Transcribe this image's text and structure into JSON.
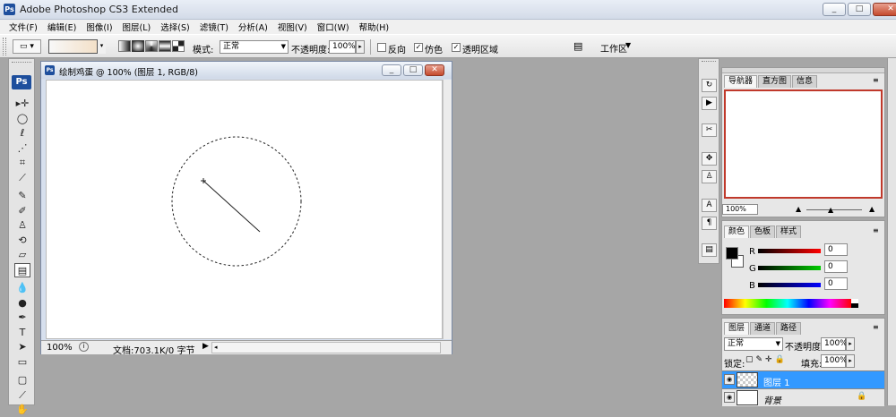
{
  "app": {
    "title": "Adobe Photoshop CS3 Extended",
    "logo": "Ps",
    "window_buttons": [
      "_",
      "□",
      "✕"
    ]
  },
  "menu": [
    "文件(F)",
    "编辑(E)",
    "图像(I)",
    "图层(L)",
    "选择(S)",
    "滤镜(T)",
    "分析(A)",
    "视图(V)",
    "窗口(W)",
    "帮助(H)"
  ],
  "options": {
    "mode_label": "模式:",
    "mode_value": "正常",
    "opacity_label": "不透明度:",
    "opacity_value": "100%",
    "reverse_label": "反向",
    "dither_label": "仿色",
    "transparency_label": "透明区域",
    "reverse_checked": false,
    "dither_checked": true,
    "transparency_checked": true,
    "workspace_label": "工作区",
    "gradient_from": "#f8f8f8",
    "gradient_to": "#f2dcc0"
  },
  "tools": [
    {
      "name": "move-tool-icon",
      "glyph": "▸✛"
    },
    {
      "name": "marquee-tool-icon",
      "glyph": "◯"
    },
    {
      "name": "lasso-tool-icon",
      "glyph": "ℓ"
    },
    {
      "name": "magic-wand-tool-icon",
      "glyph": "⋰"
    },
    {
      "name": "crop-tool-icon",
      "glyph": "⌗"
    },
    {
      "name": "eyedropper-slice-tool-icon",
      "glyph": "⟋"
    },
    {
      "name": "healing-brush-tool-icon",
      "glyph": "✎"
    },
    {
      "name": "brush-tool-icon",
      "glyph": "✐"
    },
    {
      "name": "clone-stamp-tool-icon",
      "glyph": "♙"
    },
    {
      "name": "history-brush-tool-icon",
      "glyph": "⟲"
    },
    {
      "name": "eraser-tool-icon",
      "glyph": "▱"
    },
    {
      "name": "gradient-tool-icon",
      "glyph": "▤"
    },
    {
      "name": "blur-tool-icon",
      "glyph": "💧"
    },
    {
      "name": "dodge-tool-icon",
      "glyph": "●"
    },
    {
      "name": "pen-tool-icon",
      "glyph": "✒"
    },
    {
      "name": "type-tool-icon",
      "glyph": "T"
    },
    {
      "name": "path-selection-tool-icon",
      "glyph": "➤"
    },
    {
      "name": "shape-tool-icon",
      "glyph": "▭"
    },
    {
      "name": "notes-tool-icon",
      "glyph": "▢"
    },
    {
      "name": "eyedropper-tool-icon",
      "glyph": "⟋"
    },
    {
      "name": "hand-tool-icon",
      "glyph": "✋"
    }
  ],
  "document": {
    "title": "绘制鸡蛋 @ 100% (图层 1, RGB/8)",
    "zoom": "100%",
    "status": "文档:703.1K/0 字节"
  },
  "navigator_panel": {
    "tabs": [
      "导航器",
      "直方图",
      "信息"
    ],
    "zoom": "100%"
  },
  "color_panel": {
    "tabs": [
      "颜色",
      "色板",
      "样式"
    ],
    "r_label": "R",
    "g_label": "G",
    "b_label": "B",
    "r_value": "0",
    "g_value": "0",
    "b_value": "0"
  },
  "layers_panel": {
    "tabs": [
      "图层",
      "通道",
      "路径"
    ],
    "blend_mode": "正常",
    "opacity_label": "不透明度:",
    "opacity_value": "100%",
    "lock_label": "锁定:",
    "fill_label": "填充:",
    "fill_value": "100%",
    "layers": [
      {
        "name": "图层 1",
        "selected": true
      },
      {
        "name": "背景",
        "selected": false
      }
    ]
  },
  "colors": {
    "selection_blue": "#3399ff",
    "navigator_red": "#c0392b"
  }
}
